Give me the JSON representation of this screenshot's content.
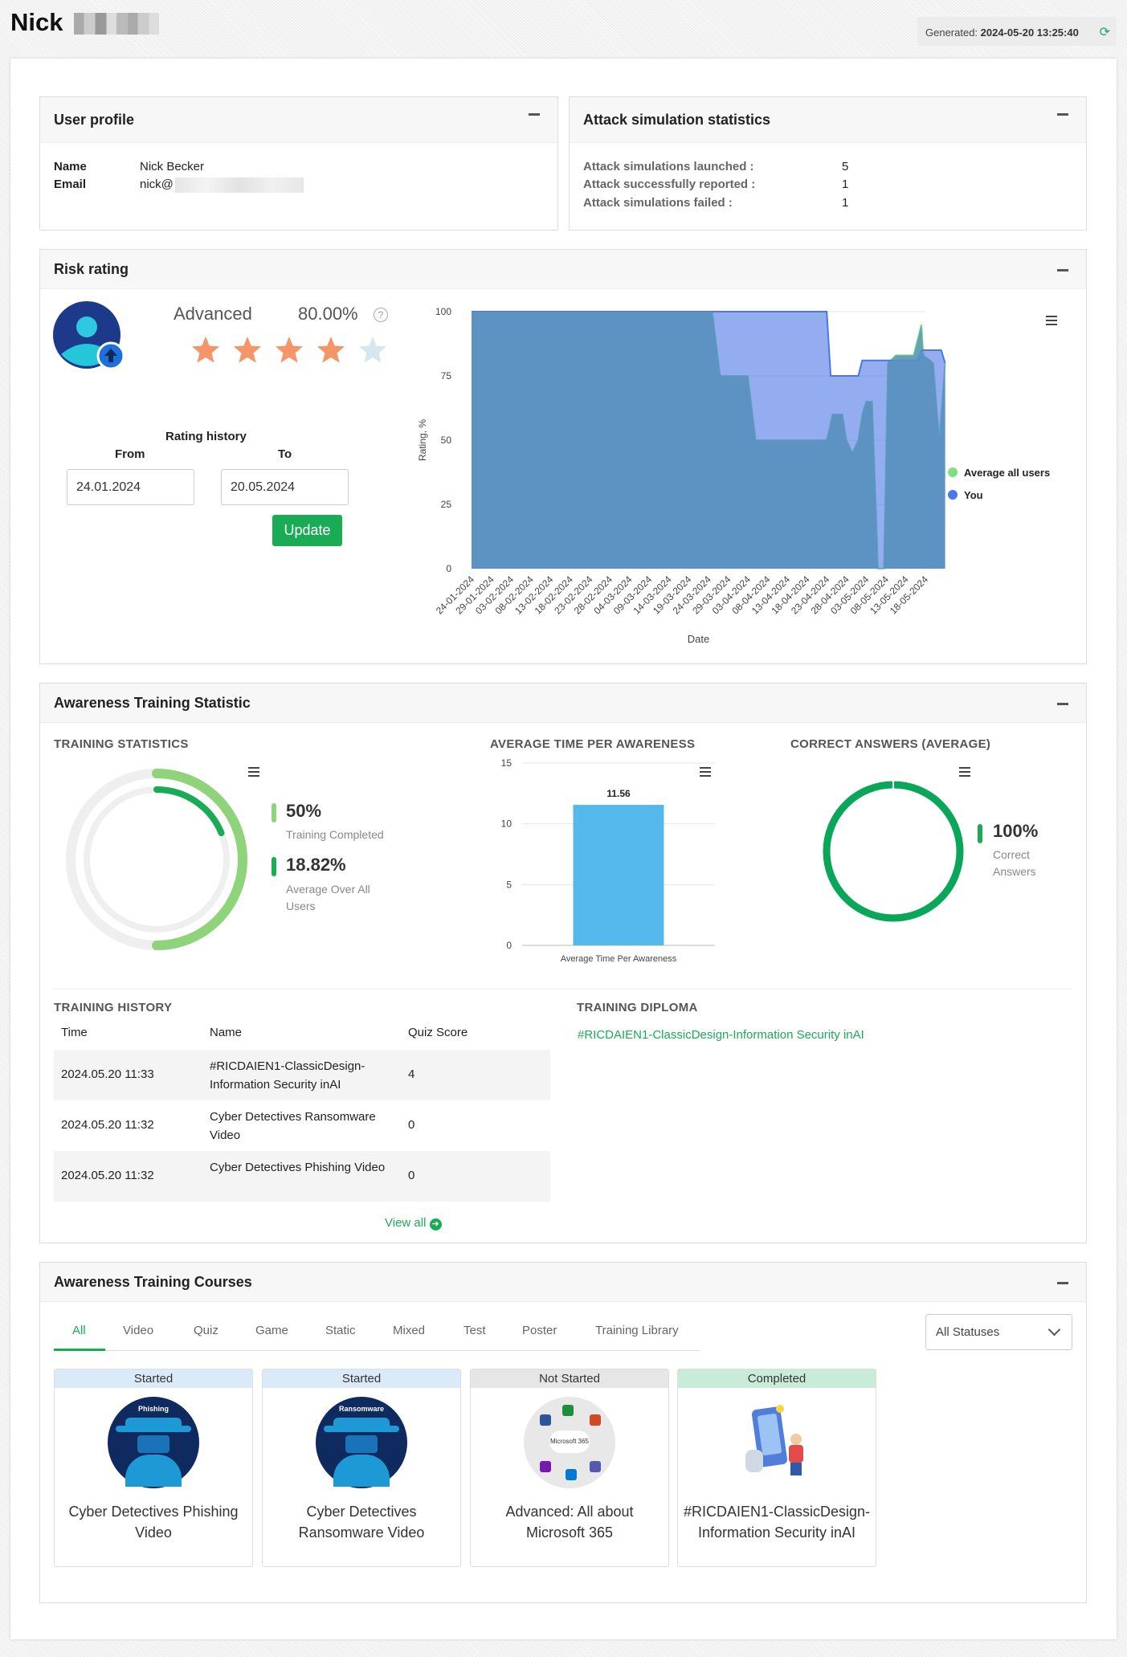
{
  "header": {
    "name": "Nick",
    "generated_label": "Generated:",
    "generated_value": "2024-05-20 13:25:40"
  },
  "profile": {
    "title": "User profile",
    "name_label": "Name",
    "name_value": "Nick Becker",
    "email_label": "Email",
    "email_value": "nick@"
  },
  "attack": {
    "title": "Attack simulation statistics",
    "rows": [
      {
        "label": "Attack simulations launched :",
        "value": "5"
      },
      {
        "label": "Attack successfully reported :",
        "value": "1"
      },
      {
        "label": "Attack simulations failed :",
        "value": "1"
      }
    ]
  },
  "risk": {
    "title": "Risk rating",
    "level": "Advanced",
    "percent": "80.00%",
    "stars_filled": 4,
    "stars_total": 5,
    "history_label": "Rating history",
    "from_label": "From",
    "to_label": "To",
    "from_value": "24.01.2024",
    "to_value": "20.05.2024",
    "update_label": "Update"
  },
  "awareness": {
    "title": "Awareness Training Statistic",
    "training_stats_title": "TRAINING STATISTICS",
    "completed_value": "50%",
    "completed_label": "Training Completed",
    "average_value": "18.82%",
    "average_label": "Average Over All Users",
    "avg_time_title": "AVERAGE TIME PER AWARENESS",
    "correct_title": "CORRECT ANSWERS (AVERAGE)",
    "correct_value": "100%",
    "correct_label": "Correct Answers",
    "history_title": "TRAINING HISTORY",
    "history_headers": [
      "Time",
      "Name",
      "Quiz Score"
    ],
    "history_rows": [
      {
        "time": "2024.05.20 11:33",
        "name": "#RICDAIEN1-ClassicDesign-Information Security inAI",
        "score": "4"
      },
      {
        "time": "2024.05.20 11:32",
        "name": "Cyber Detectives Ransomware Video",
        "score": "0"
      },
      {
        "time": "2024.05.20 11:32",
        "name": "Cyber Detectives Phishing Video",
        "score": "0"
      }
    ],
    "view_all": "View all",
    "diploma_title": "TRAINING DIPLOMA",
    "diploma_link": "#RICDAIEN1-ClassicDesign-Information Security inAI"
  },
  "courses": {
    "title": "Awareness Training Courses",
    "tabs": [
      "All",
      "Video",
      "Quiz",
      "Game",
      "Static",
      "Mixed",
      "Test",
      "Poster",
      "Training Library"
    ],
    "status_filter": "All Statuses",
    "cards": [
      {
        "status": "Started",
        "title": "Cyber Detectives Phishing Video",
        "badge": "Phishing"
      },
      {
        "status": "Started",
        "title": "Cyber Detectives Ransomware Video",
        "badge": "Ransomware"
      },
      {
        "status": "Not Started",
        "title": "Advanced: All about Microsoft 365",
        "badge": "Microsoft 365"
      },
      {
        "status": "Completed",
        "title": "#RICDAIEN1-ClassicDesign-Information Security inAI",
        "badge": ""
      }
    ]
  },
  "colors": {
    "accent": "#1aab55",
    "you": "#4d76e6",
    "average": "#7fe07f",
    "started": "#dbeaf8",
    "not_started": "#e6e6e6",
    "completed": "#c9ecd8"
  },
  "chart_data": [
    {
      "type": "area",
      "title": "",
      "ylabel": "Rating, %",
      "xlabel": "Date",
      "ylim": [
        0,
        100
      ],
      "yticks": [
        0,
        25,
        50,
        75,
        100
      ],
      "categories": [
        "24-01-2024",
        "29-01-2024",
        "03-02-2024",
        "08-02-2024",
        "13-02-2024",
        "18-02-2024",
        "23-02-2024",
        "28-02-2024",
        "04-03-2024",
        "09-03-2024",
        "14-03-2024",
        "19-03-2024",
        "24-03-2024",
        "29-03-2024",
        "03-04-2024",
        "08-04-2024",
        "13-04-2024",
        "18-04-2024",
        "23-04-2024",
        "28-04-2024",
        "03-05-2024",
        "08-05-2024",
        "13-05-2024",
        "18-05-2024"
      ],
      "legend": "right",
      "series": [
        {
          "name": "Average all users",
          "points": [
            [
              0,
              100
            ],
            [
              2.2,
              100
            ],
            [
              12.2,
              100
            ],
            [
              12.6,
              75
            ],
            [
              14,
              75
            ],
            [
              14.4,
              50
            ],
            [
              18,
              50
            ],
            [
              18.3,
              60
            ],
            [
              18.8,
              60
            ],
            [
              19,
              50
            ],
            [
              19.3,
              45
            ],
            [
              19.6,
              50
            ],
            [
              19.8,
              60
            ],
            [
              20,
              65
            ],
            [
              20.3,
              65
            ],
            [
              20.6,
              0
            ],
            [
              20.9,
              0
            ],
            [
              21.1,
              80
            ],
            [
              21.5,
              83
            ],
            [
              22.4,
              83
            ],
            [
              22.8,
              95
            ],
            [
              22.9,
              83
            ],
            [
              23.4,
              80
            ],
            [
              23.7,
              50
            ],
            [
              24,
              80
            ]
          ]
        },
        {
          "name": "You",
          "points": [
            [
              0,
              100
            ],
            [
              18,
              100
            ],
            [
              18.2,
              75
            ],
            [
              19.6,
              75
            ],
            [
              19.8,
              81
            ],
            [
              22.6,
              81
            ],
            [
              22.8,
              85
            ],
            [
              23.8,
              85
            ],
            [
              24,
              80
            ]
          ]
        }
      ]
    },
    {
      "type": "bar",
      "title": "",
      "categories": [
        "Average Time Per Awareness"
      ],
      "values": [
        11.56
      ],
      "ylim": [
        0,
        15
      ],
      "yticks": [
        0,
        5,
        10,
        15
      ]
    }
  ]
}
